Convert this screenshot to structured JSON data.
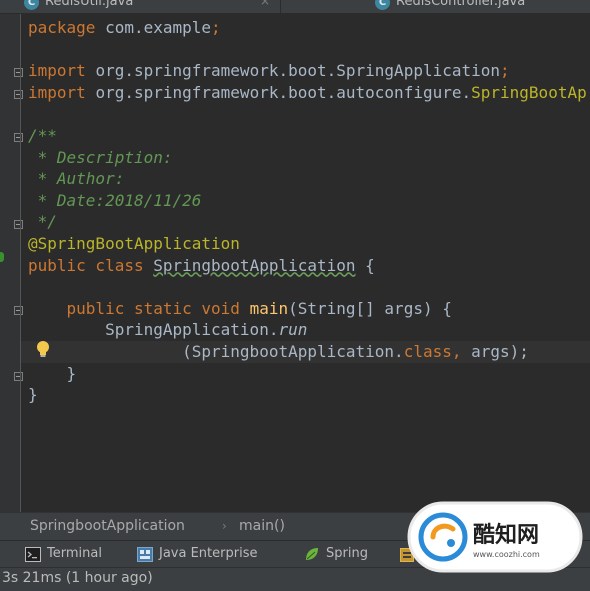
{
  "tabs": [
    {
      "icon": "class-icon",
      "icon_letter": "C",
      "label": "RedisUtil.java",
      "close": "×"
    },
    {
      "icon": "class-icon",
      "icon_letter": "C",
      "label": "RedisController.java"
    }
  ],
  "code": {
    "lines": [
      {
        "parts": [
          [
            "kw",
            "package "
          ],
          [
            "",
            "com.example"
          ],
          [
            "kw",
            ";"
          ]
        ]
      },
      {
        "parts": []
      },
      {
        "parts": [
          [
            "kw",
            "import "
          ],
          [
            "",
            "org.springframework.boot.SpringApplication"
          ],
          [
            "kw",
            ";"
          ]
        ]
      },
      {
        "parts": [
          [
            "kw",
            "import "
          ],
          [
            "",
            "org.springframework.boot.autoconfigure."
          ],
          [
            "an",
            "SpringBootAp"
          ]
        ]
      },
      {
        "parts": []
      },
      {
        "parts": [
          [
            "cm",
            "/**"
          ]
        ]
      },
      {
        "parts": [
          [
            "cm",
            " * Description:"
          ]
        ]
      },
      {
        "parts": [
          [
            "cm",
            " * Author:"
          ]
        ]
      },
      {
        "parts": [
          [
            "cm",
            " * Date:2018/11/26"
          ]
        ]
      },
      {
        "parts": [
          [
            "cm",
            " */"
          ]
        ]
      },
      {
        "parts": [
          [
            "an",
            "@SpringBootApplication"
          ]
        ]
      },
      {
        "parts": [
          [
            "kw",
            "public class "
          ],
          [
            "ul",
            "SpringbootApplication"
          ],
          [
            "",
            " {"
          ]
        ]
      },
      {
        "parts": []
      },
      {
        "parts": [
          [
            "",
            "    "
          ],
          [
            "kw",
            "public static void "
          ],
          [
            "fn",
            "main"
          ],
          [
            "",
            "(String[] args) {"
          ]
        ]
      },
      {
        "parts": [
          [
            "",
            "        SpringApplication."
          ],
          [
            "it",
            "run"
          ]
        ]
      },
      {
        "parts": [
          [
            "",
            "                (SpringbootApplication."
          ],
          [
            "kw",
            "class, "
          ],
          [
            "",
            "args);"
          ]
        ]
      },
      {
        "parts": [
          [
            "",
            "    }"
          ]
        ]
      },
      {
        "parts": [
          [
            "",
            "}"
          ]
        ]
      }
    ]
  },
  "breadcrumb": {
    "class_name": "SpringbootApplication",
    "separator": "›",
    "method": "main()"
  },
  "tool_windows": [
    {
      "icon": "terminal-icon",
      "label": "Terminal"
    },
    {
      "icon": "java-enterprise-icon",
      "label": "Java Enterprise"
    },
    {
      "icon": "spring-leaf-icon",
      "label": "Spring"
    }
  ],
  "status": {
    "message": "3s 21ms (1 hour ago)"
  },
  "watermark": {
    "brand": "酷知网",
    "url": "www.coozhi.com"
  },
  "colors": {
    "editor_bg": "#2b2b2b",
    "keyword": "#cc7832",
    "comment": "#629755",
    "annotation": "#bbb529",
    "method": "#ffc66d",
    "text": "#a9b7c6"
  }
}
